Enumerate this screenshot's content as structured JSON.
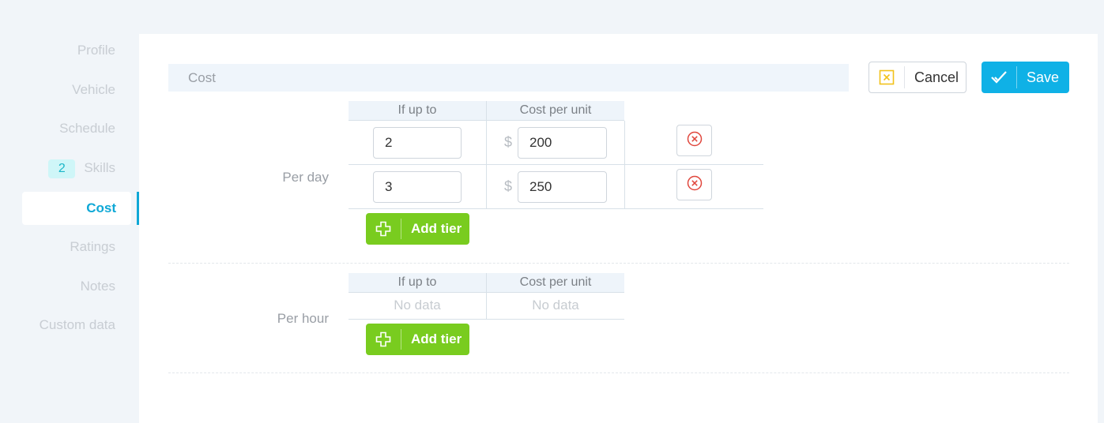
{
  "sidebar": {
    "items": [
      {
        "label": "Profile"
      },
      {
        "label": "Vehicle"
      },
      {
        "label": "Schedule"
      },
      {
        "label": "Skills",
        "badge": "2"
      },
      {
        "label": "Cost",
        "active": true
      },
      {
        "label": "Ratings"
      },
      {
        "label": "Notes"
      },
      {
        "label": "Custom data"
      }
    ]
  },
  "section": {
    "title": "Cost"
  },
  "actions": {
    "cancel_label": "Cancel",
    "save_label": "Save"
  },
  "per_day": {
    "label": "Per day",
    "columns": [
      "If up to",
      "Cost per unit"
    ],
    "currency": "$",
    "tiers": [
      {
        "if_up_to": "2",
        "cost_per_unit": "200"
      },
      {
        "if_up_to": "3",
        "cost_per_unit": "250"
      }
    ],
    "add_label": "Add tier"
  },
  "per_hour": {
    "label": "Per hour",
    "columns": [
      "If up to",
      "Cost per unit"
    ],
    "empty_text": [
      "No data",
      "No data"
    ],
    "add_label": "Add tier"
  },
  "colors": {
    "accent": "#0fb1e6",
    "add": "#79cc1f",
    "delete": "#e0473d",
    "cancel_icon": "#f2c21a"
  }
}
